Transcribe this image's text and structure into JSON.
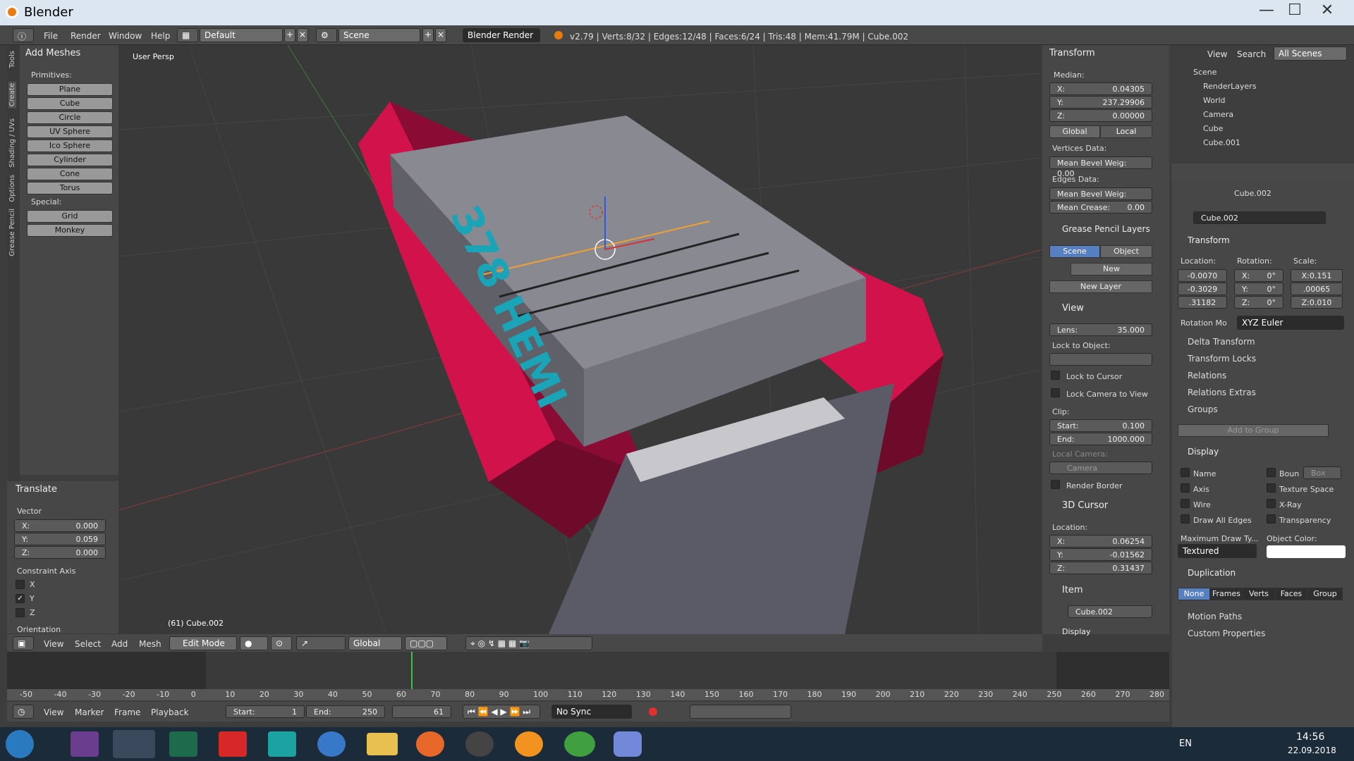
{
  "window": {
    "title": "Blender"
  },
  "menu": {
    "items": [
      "File",
      "Render",
      "Window",
      "Help"
    ],
    "layout": "Default",
    "scene": "Scene",
    "engine": "Blender Render"
  },
  "status": "v2.79 | Verts:8/32 | Edges:12/48 | Faces:6/24 | Tris:48 | Mem:41.79M | Cube.002",
  "tools": {
    "tabs": [
      "Tools",
      "Create",
      "Shading / UVs",
      "Options",
      "Grease Pencil"
    ],
    "header": "Add Meshes",
    "primitives_label": "Primitives:",
    "primitives": [
      "Plane",
      "Cube",
      "Circle",
      "UV Sphere",
      "Ico Sphere",
      "Cylinder",
      "Cone",
      "Torus"
    ],
    "special_label": "Special:",
    "special": [
      "Grid",
      "Monkey"
    ]
  },
  "translate": {
    "header": "Translate",
    "vector_label": "Vector",
    "x": "0.000",
    "y": "0.059",
    "z": "0.000",
    "constraint_label": "Constraint Axis",
    "axes": [
      {
        "name": "X",
        "checked": false
      },
      {
        "name": "Y",
        "checked": true
      },
      {
        "name": "Z",
        "checked": false
      }
    ],
    "orientation_label": "Orientation"
  },
  "viewport": {
    "label": "User Persp",
    "object_label": "(61) Cube.002",
    "text_on_model": "378 HEMI"
  },
  "viewport_header": {
    "items": [
      "View",
      "Select",
      "Add",
      "Mesh"
    ],
    "mode": "Edit Mode",
    "orientation": "Global"
  },
  "properties_n": {
    "transform_header": "Transform",
    "median_label": "Median:",
    "x": "0.04305",
    "y": "237.29906",
    "z": "0.00000",
    "global": "Global",
    "local": "Local",
    "vertices_data": "Vertices Data:",
    "mean_bevel_v": "Mean Bevel Weig: 0.00",
    "edges_data": "Edges Data:",
    "mean_bevel_e": "Mean Bevel Weig: 0.00",
    "mean_crease": "Mean Crease:",
    "mean_crease_val": "0.00",
    "grease_header": "Grease Pencil Layers",
    "gp_scene": "Scene",
    "gp_object": "Object",
    "gp_new": "New",
    "gp_new_layer": "New Layer",
    "view_header": "View",
    "lens_label": "Lens:",
    "lens": "35.000",
    "lock_obj": "Lock to Object:",
    "lock_cursor": "Lock to Cursor",
    "lock_camera": "Lock Camera to View",
    "clip": "Clip:",
    "clip_start_l": "Start:",
    "clip_start": "0.100",
    "clip_end_l": "End:",
    "clip_end": "1000.000",
    "local_camera": "Local Camera:",
    "camera": "Camera",
    "render_border": "Render Border",
    "cursor_header": "3D Cursor",
    "location": "Location:",
    "cx": "0.06254",
    "cy": "-0.01562",
    "cz": "0.31437",
    "item_header": "Item",
    "item_name": "Cube.002",
    "display_header": "Display"
  },
  "outliner": {
    "menu": [
      "View",
      "Search"
    ],
    "filter": "All Scenes",
    "rows": [
      "Scene",
      "RenderLayers",
      "World",
      "Camera",
      "Cube",
      "Cube.001"
    ]
  },
  "props": {
    "object_crumb": "Cube.002",
    "object_name": "Cube.002",
    "transform_header": "Transform",
    "location_l": "Location:",
    "rotation_l": "Rotation:",
    "scale_l": "Scale:",
    "loc": [
      "-0.0070",
      "-0.3029",
      ".31182"
    ],
    "rot": [
      "0°",
      "0°",
      "0°"
    ],
    "rot_axes": [
      "X:",
      "Y:",
      "Z:"
    ],
    "scale": [
      "X:0.151",
      ".00065",
      "Z:0.010"
    ],
    "rotation_mode_l": "Rotation Mo",
    "rotation_mode": "XYZ Euler",
    "collapsed": [
      "Delta Transform",
      "Transform Locks",
      "Relations",
      "Relations Extras"
    ],
    "groups_header": "Groups",
    "add_to_group": "Add to Group",
    "display_header": "Display",
    "disp_left": [
      "Name",
      "Axis",
      "Wire",
      "Draw All Edges"
    ],
    "disp_right": [
      "Boun",
      "Texture Space",
      "X-Ray",
      "Transparency"
    ],
    "bound_type": "Box",
    "max_draw_l": "Maximum Draw Ty...",
    "object_color_l": "Object Color:",
    "max_draw": "Textured",
    "duplication_header": "Duplication",
    "dup_tabs": [
      "None",
      "Frames",
      "Verts",
      "Faces",
      "Group"
    ],
    "motion_paths": "Motion Paths",
    "custom_props": "Custom Properties"
  },
  "timeline": {
    "ticks": [
      "-50",
      "-40",
      "-30",
      "-20",
      "-10",
      "0",
      "10",
      "20",
      "30",
      "40",
      "50",
      "60",
      "70",
      "80",
      "90",
      "100",
      "110",
      "120",
      "130",
      "140",
      "150",
      "160",
      "170",
      "180",
      "190",
      "200",
      "210",
      "220",
      "230",
      "240",
      "250",
      "260",
      "270",
      "280"
    ],
    "menu": [
      "View",
      "Marker",
      "Frame",
      "Playback"
    ],
    "start_l": "Start:",
    "start": "1",
    "end_l": "End:",
    "end": "250",
    "current": "61",
    "sync": "No Sync"
  },
  "taskbar": {
    "lang": "EN",
    "time": "14:56",
    "date": "22.09.2018"
  }
}
